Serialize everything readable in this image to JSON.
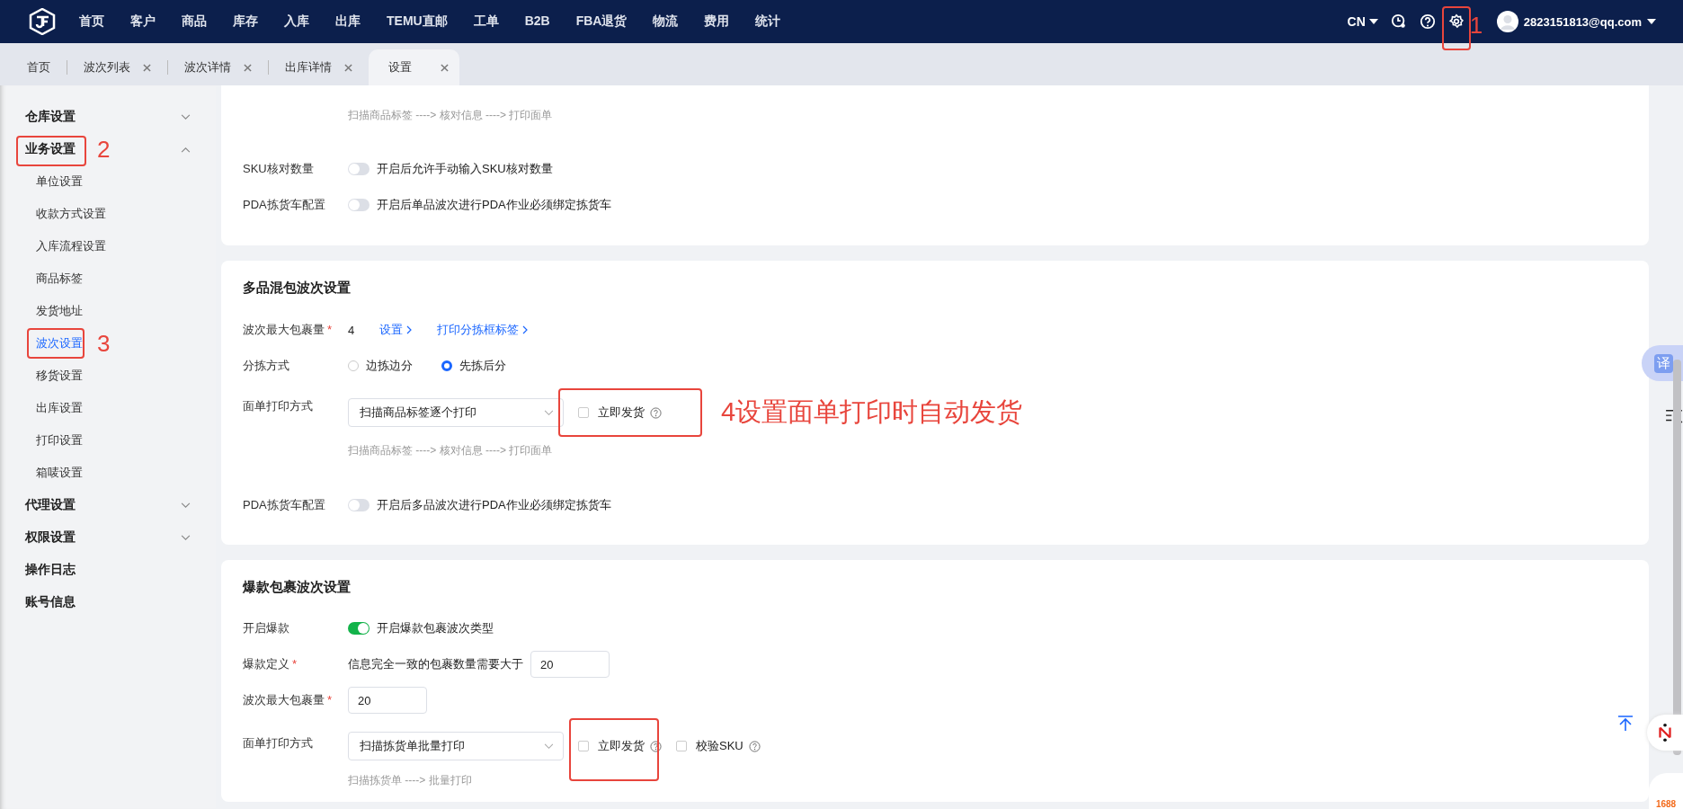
{
  "nav": {
    "items": [
      "首页",
      "客户",
      "商品",
      "库存",
      "入库",
      "出库",
      "TEMU直邮",
      "工单",
      "B2B",
      "FBA退货",
      "物流",
      "费用",
      "统计"
    ]
  },
  "top_right": {
    "language": "CN",
    "user": "2823151813@qq.com",
    "settings_note": "1"
  },
  "tabs": [
    {
      "label": "首页",
      "selected": false,
      "closable": false
    },
    {
      "label": "波次列表",
      "selected": false,
      "closable": true
    },
    {
      "label": "波次详情",
      "selected": false,
      "closable": true
    },
    {
      "label": "出库详情",
      "selected": false,
      "closable": true
    },
    {
      "label": "设置",
      "selected": true,
      "closable": true
    }
  ],
  "sidebar": {
    "items": [
      {
        "label": "仓库设置",
        "kind": "group",
        "expanded": false
      },
      {
        "label": "业务设置",
        "kind": "group",
        "expanded": true,
        "note": "2",
        "children": [
          {
            "label": "单位设置",
            "selected": false
          },
          {
            "label": "收款方式设置",
            "selected": false
          },
          {
            "label": "入库流程设置",
            "selected": false
          },
          {
            "label": "商品标签",
            "selected": false
          },
          {
            "label": "发货地址",
            "selected": false
          },
          {
            "label": "波次设置",
            "selected": true,
            "note": "3"
          },
          {
            "label": "移货设置",
            "selected": false
          },
          {
            "label": "出库设置",
            "selected": false
          },
          {
            "label": "打印设置",
            "selected": false
          },
          {
            "label": "箱唛设置",
            "selected": false
          }
        ]
      },
      {
        "label": "代理设置",
        "kind": "group",
        "expanded": false
      },
      {
        "label": "权限设置",
        "kind": "group",
        "expanded": false
      },
      {
        "label": "操作日志",
        "kind": "link"
      },
      {
        "label": "账号信息",
        "kind": "link"
      }
    ]
  },
  "sections": [
    {
      "rows": [
        {
          "kind": "hint",
          "text": "扫描商品标签 ----> 核对信息 ----> 打印面单"
        },
        {
          "kind": "switch",
          "label": "SKU核对数量",
          "on": false,
          "text": "开启后允许手动输入SKU核对数量"
        },
        {
          "kind": "switch",
          "label": "PDA拣货车配置",
          "on": false,
          "text": "开启后单品波次进行PDA作业必须绑定拣货车"
        }
      ]
    },
    {
      "title": "多品混包波次设置",
      "rows": [
        {
          "kind": "value",
          "label": "波次最大包裹量",
          "required": "*",
          "value": "4",
          "links": [
            "设置",
            "打印分拣框标签"
          ]
        },
        {
          "kind": "radio",
          "label": "分拣方式",
          "options": [
            {
              "label": "边拣边分",
              "selected": false
            },
            {
              "label": "先拣后分",
              "selected": true
            }
          ]
        },
        {
          "kind": "print",
          "label": "面单打印方式",
          "select": "扫描商品标签逐个打印",
          "checks": [
            {
              "label": "立即发货",
              "checked": false,
              "help": true,
              "annotated": true,
              "note": "4设置面单打印时自动发货"
            }
          ],
          "hint": "扫描商品标签 ----> 核对信息 ----> 打印面单"
        },
        {
          "kind": "switch",
          "label": "PDA拣货车配置",
          "on": false,
          "text": "开启后多品波次进行PDA作业必须绑定拣货车"
        }
      ]
    },
    {
      "title": "爆款包裹波次设置",
      "rows": [
        {
          "kind": "switch",
          "label": "开启爆款",
          "on": true,
          "text": "开启爆款包裹波次类型"
        },
        {
          "kind": "input",
          "label": "爆款定义",
          "required": "*",
          "prefix": "信息完全一致的包裹数量需要大于",
          "value": "20"
        },
        {
          "kind": "input",
          "label": "波次最大包裹量",
          "required": "*",
          "value": "20"
        },
        {
          "kind": "print",
          "label": "面单打印方式",
          "select": "扫描拣货单批量打印",
          "checks": [
            {
              "label": "立即发货",
              "checked": false,
              "help": true,
              "annotated": true
            },
            {
              "label": "校验SKU",
              "checked": false,
              "help": true
            }
          ],
          "hint": "扫描拣货单 ----> 批量打印"
        }
      ]
    }
  ],
  "float": {
    "translate": "译",
    "brand": "1688"
  }
}
